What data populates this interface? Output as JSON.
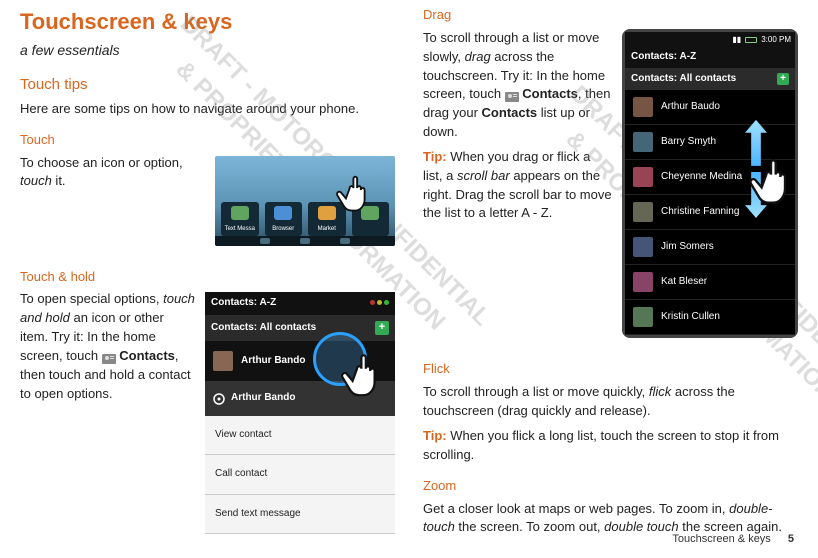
{
  "page": {
    "title": "Touchscreen & keys",
    "subtitle": "a few essentials",
    "footer_label": "Touchscreen & keys",
    "page_number": "5"
  },
  "left": {
    "touch_tips": {
      "heading": "Touch tips",
      "body": "Here are some tips on how to navigate around your phone."
    },
    "touch": {
      "heading": "Touch",
      "body_pre": "To choose an icon or option, ",
      "body_kw": "touch",
      "body_post": " it."
    },
    "touch_hold": {
      "heading": "Touch & hold",
      "body_pre": "To open special options, ",
      "body_kw": "touch and hold",
      "body_mid": " an icon or other item. Try it: In the home screen, touch ",
      "contacts_label": "Contacts",
      "body_post": ", then touch and hold a contact to open options."
    },
    "fig_home": {
      "apps": [
        "Text Messa",
        "Browser",
        "Market"
      ]
    },
    "fig_th": {
      "bar1": "Contacts: A-Z",
      "bar2": "Contacts: All contacts",
      "selected": "Arthur Bando",
      "menu_title": "Arthur Bando",
      "items": [
        "View contact",
        "Call contact",
        "Send text message"
      ]
    }
  },
  "right": {
    "drag": {
      "heading": "Drag",
      "body_pre": "To scroll through a list or move slowly, ",
      "body_kw": "drag",
      "body_mid1": " across the touchscreen. Try it: In the home screen, touch ",
      "contacts_label": "Contacts",
      "body_mid2": ", then drag your ",
      "contacts_bold": "Contacts",
      "body_post": " list up or down.",
      "tip_label": "Tip:",
      "tip_body_pre": " When you drag or flick a list, a ",
      "tip_kw": "scroll bar",
      "tip_body_post": " appears on the right. Drag the scroll bar to move the list to a letter A - Z."
    },
    "fig_drag": {
      "time": "3:00 PM",
      "bar1": "Contacts: A-Z",
      "bar2": "Contacts: All contacts",
      "list": [
        "Arthur Baudo",
        "Barry Smyth",
        "Cheyenne Medina",
        "Christine Fanning",
        "Jim Somers",
        "Kat Bleser",
        "Kristin Cullen"
      ]
    },
    "flick": {
      "heading": "Flick",
      "body_pre": "To scroll through a list or move quickly, ",
      "body_kw": "flick",
      "body_post": " across the touchscreen (drag quickly and release).",
      "tip_label": "Tip:",
      "tip_body": " When you flick a long list, touch the screen to stop it from scrolling."
    },
    "zoom": {
      "heading": "Zoom",
      "body_pre": "Get a closer look at maps or web pages. To zoom in, ",
      "body_kw1": "double-touch",
      "body_mid": " the screen. To zoom out, ",
      "body_kw2": "double touch",
      "body_post": " the screen again."
    }
  },
  "watermark": {
    "line1": "DRAFT - MOTOROLA CONFIDENTIAL",
    "line2": "& PROPRIETARY INFORMATION"
  }
}
